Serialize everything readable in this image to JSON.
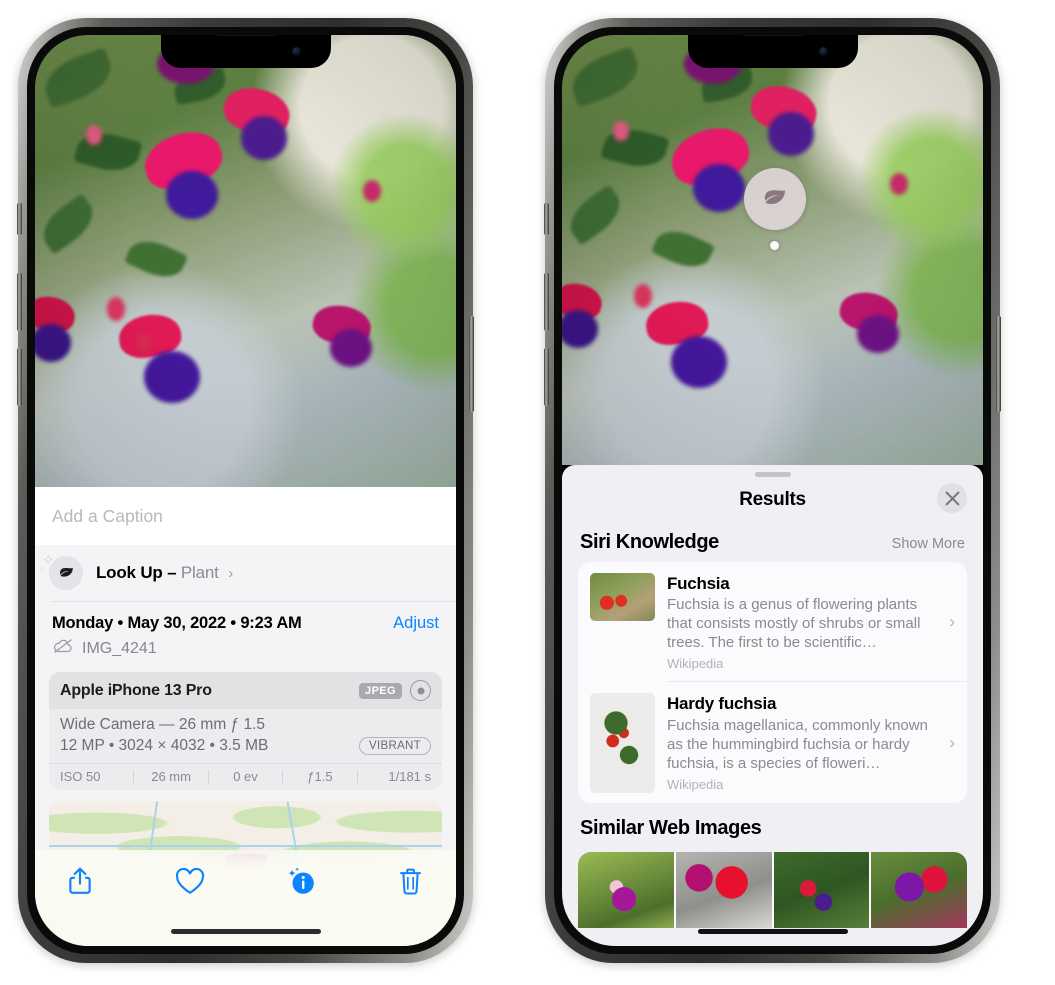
{
  "left_phone": {
    "caption_field": {
      "placeholder": "Add a Caption",
      "value": ""
    },
    "lookup_row": {
      "label": "Look Up",
      "dash": "–",
      "kind": "Plant",
      "chevron": "›",
      "icon": "leaf-icon"
    },
    "date_row": {
      "date": "Monday • May 30, 2022 • 9:23 AM",
      "adjust_label": "Adjust"
    },
    "file_row": {
      "filename": "IMG_4241",
      "icon": "cloud-slash-icon"
    },
    "camera_card": {
      "device": "Apple iPhone 13 Pro",
      "format_chip": "JPEG",
      "aperture_icon": "aperture-icon",
      "lens_line": "Wide Camera — 26 mm ƒ 1.5",
      "specs_line": "12 MP • 3024 × 4032 • 3.5 MB",
      "style_chip": "VIBRANT",
      "exif": [
        "ISO 50",
        "26 mm",
        "0 ev",
        "ƒ1.5",
        "1/181 s"
      ]
    },
    "toolbar": [
      {
        "name": "share-button",
        "icon": "share-icon"
      },
      {
        "name": "favorite-button",
        "icon": "heart-icon"
      },
      {
        "name": "info-button",
        "icon": "info-sparkle-icon"
      },
      {
        "name": "delete-button",
        "icon": "trash-icon"
      }
    ]
  },
  "right_phone": {
    "visual_lookup_badge": {
      "icon": "leaf-icon"
    },
    "sheet": {
      "title": "Results",
      "close_icon": "close-icon",
      "siri_knowledge": {
        "title": "Siri Knowledge",
        "show_more": "Show More",
        "items": [
          {
            "name": "Fuchsia",
            "description": "Fuchsia is a genus of flowering plants that consists mostly of shrubs or small trees. The first to be scientific…",
            "source": "Wikipedia",
            "chevron": "›"
          },
          {
            "name": "Hardy fuchsia",
            "description": "Fuchsia magellanica, commonly known as the hummingbird fuchsia or hardy fuchsia, is a species of floweri…",
            "source": "Wikipedia",
            "chevron": "›"
          }
        ]
      },
      "similar_web_images": {
        "title": "Similar Web Images",
        "thumbnails": [
          "fuchsia-thumb-1",
          "fuchsia-thumb-2",
          "fuchsia-thumb-3",
          "fuchsia-thumb-4"
        ]
      }
    }
  },
  "colors": {
    "accent_blue": "#0a84ff",
    "sheet_bg": "#f0eff4",
    "card_bg": "#fbfbfd",
    "secondary_text": "#8a8a8f"
  }
}
